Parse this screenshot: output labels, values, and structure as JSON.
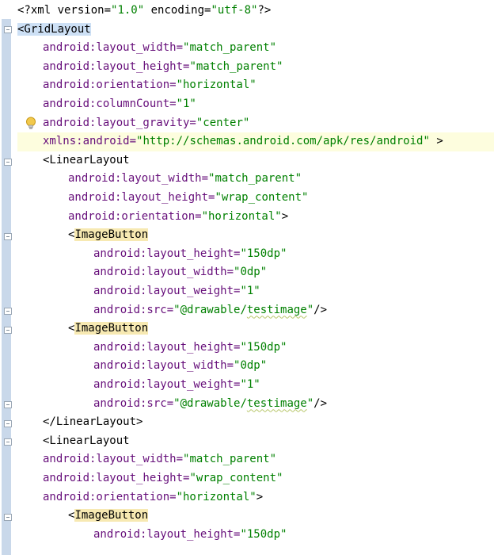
{
  "editor": {
    "lines": [
      {
        "indent": 0,
        "parts": [
          {
            "k": "t",
            "s": "<?"
          },
          {
            "k": "t",
            "s": "xml version="
          },
          {
            "k": "v",
            "s": "\"1.0\""
          },
          {
            "k": "t",
            "s": " encoding="
          },
          {
            "k": "v",
            "s": "\"utf-8\""
          },
          {
            "k": "t",
            "s": "?>"
          }
        ]
      },
      {
        "indent": 0,
        "parts": [
          {
            "k": "tf",
            "s": "<GridLayout"
          }
        ]
      },
      {
        "indent": 1,
        "parts": [
          {
            "k": "a",
            "s": "android:layout_width="
          },
          {
            "k": "v",
            "s": "\"match_parent\""
          }
        ]
      },
      {
        "indent": 1,
        "parts": [
          {
            "k": "a",
            "s": "android:layout_height="
          },
          {
            "k": "v",
            "s": "\"match_parent\""
          }
        ]
      },
      {
        "indent": 1,
        "parts": [
          {
            "k": "a",
            "s": "android:orientation="
          },
          {
            "k": "v",
            "s": "\"horizontal\""
          }
        ]
      },
      {
        "indent": 1,
        "parts": [
          {
            "k": "a",
            "s": "android:columnCount="
          },
          {
            "k": "v",
            "s": "\"1\""
          }
        ]
      },
      {
        "indent": 1,
        "parts": [
          {
            "k": "a",
            "s": "android:layout_gravity="
          },
          {
            "k": "v",
            "s": "\"center\""
          }
        ]
      },
      {
        "indent": 1,
        "caret": true,
        "parts": [
          {
            "k": "a",
            "s": "xmlns:android="
          },
          {
            "k": "v",
            "s": "\"http://schemas.android.com/apk/res/android\""
          },
          {
            "k": "t",
            "s": " >"
          }
        ]
      },
      {
        "indent": 1,
        "parts": [
          {
            "k": "t",
            "s": "<LinearLayout"
          }
        ]
      },
      {
        "indent": 2,
        "parts": [
          {
            "k": "a",
            "s": "android:layout_width="
          },
          {
            "k": "v",
            "s": "\"match_parent\""
          }
        ]
      },
      {
        "indent": 2,
        "parts": [
          {
            "k": "a",
            "s": "android:layout_height="
          },
          {
            "k": "v",
            "s": "\"wrap_content\""
          }
        ]
      },
      {
        "indent": 2,
        "parts": [
          {
            "k": "a",
            "s": "android:orientation="
          },
          {
            "k": "v",
            "s": "\"horizontal\""
          },
          {
            "k": "t",
            "s": ">"
          }
        ]
      },
      {
        "indent": 2,
        "parts": [
          {
            "k": "t",
            "s": "<"
          },
          {
            "k": "ts",
            "s": "ImageButton"
          }
        ]
      },
      {
        "indent": 3,
        "parts": [
          {
            "k": "a",
            "s": "android:layout_height="
          },
          {
            "k": "v",
            "s": "\"150dp\""
          }
        ]
      },
      {
        "indent": 3,
        "parts": [
          {
            "k": "a",
            "s": "android:layout_width="
          },
          {
            "k": "v",
            "s": "\"0dp\""
          }
        ]
      },
      {
        "indent": 3,
        "parts": [
          {
            "k": "a",
            "s": "android:layout_weight="
          },
          {
            "k": "v",
            "s": "\"1\""
          }
        ]
      },
      {
        "indent": 3,
        "parts": [
          {
            "k": "a",
            "s": "android:src="
          },
          {
            "k": "v",
            "s": "\"@drawable/"
          },
          {
            "k": "vq",
            "s": "testimage"
          },
          {
            "k": "v",
            "s": "\""
          },
          {
            "k": "t",
            "s": "/>"
          }
        ]
      },
      {
        "indent": 2,
        "parts": [
          {
            "k": "t",
            "s": "<"
          },
          {
            "k": "ts",
            "s": "ImageButton"
          }
        ]
      },
      {
        "indent": 3,
        "parts": [
          {
            "k": "a",
            "s": "android:layout_height="
          },
          {
            "k": "v",
            "s": "\"150dp\""
          }
        ]
      },
      {
        "indent": 3,
        "parts": [
          {
            "k": "a",
            "s": "android:layout_width="
          },
          {
            "k": "v",
            "s": "\"0dp\""
          }
        ]
      },
      {
        "indent": 3,
        "parts": [
          {
            "k": "a",
            "s": "android:layout_weight="
          },
          {
            "k": "v",
            "s": "\"1\""
          }
        ]
      },
      {
        "indent": 3,
        "parts": [
          {
            "k": "a",
            "s": "android:src="
          },
          {
            "k": "v",
            "s": "\"@drawable/"
          },
          {
            "k": "vq",
            "s": "testimage"
          },
          {
            "k": "v",
            "s": "\""
          },
          {
            "k": "t",
            "s": "/>"
          }
        ]
      },
      {
        "indent": 1,
        "parts": [
          {
            "k": "t",
            "s": "</LinearLayout>"
          }
        ]
      },
      {
        "indent": 1,
        "parts": [
          {
            "k": "t",
            "s": "<LinearLayout"
          }
        ]
      },
      {
        "indent": 1,
        "parts": [
          {
            "k": "a",
            "s": "android:layout_width="
          },
          {
            "k": "v",
            "s": "\"match_parent\""
          }
        ]
      },
      {
        "indent": 1,
        "parts": [
          {
            "k": "a",
            "s": "android:layout_height="
          },
          {
            "k": "v",
            "s": "\"wrap_content\""
          }
        ]
      },
      {
        "indent": 1,
        "parts": [
          {
            "k": "a",
            "s": "android:orientation="
          },
          {
            "k": "v",
            "s": "\"horizontal\""
          },
          {
            "k": "t",
            "s": ">"
          }
        ]
      },
      {
        "indent": 2,
        "parts": [
          {
            "k": "t",
            "s": "<"
          },
          {
            "k": "ts",
            "s": "ImageButton"
          }
        ]
      },
      {
        "indent": 3,
        "parts": [
          {
            "k": "a",
            "s": "android:layout_height="
          },
          {
            "k": "v",
            "s": "\"150dp\""
          }
        ]
      }
    ]
  },
  "gutter": {
    "bulb_icon": "lightbulb-icon"
  },
  "colors": {
    "attribute": "#660e7a",
    "value": "#008000",
    "tag": "#000000",
    "caret_line": "#fdfdde",
    "matched_tag": "#f7e9b2",
    "selected_tag": "#cde0f5",
    "fold_bar": "#c9d8ea"
  }
}
